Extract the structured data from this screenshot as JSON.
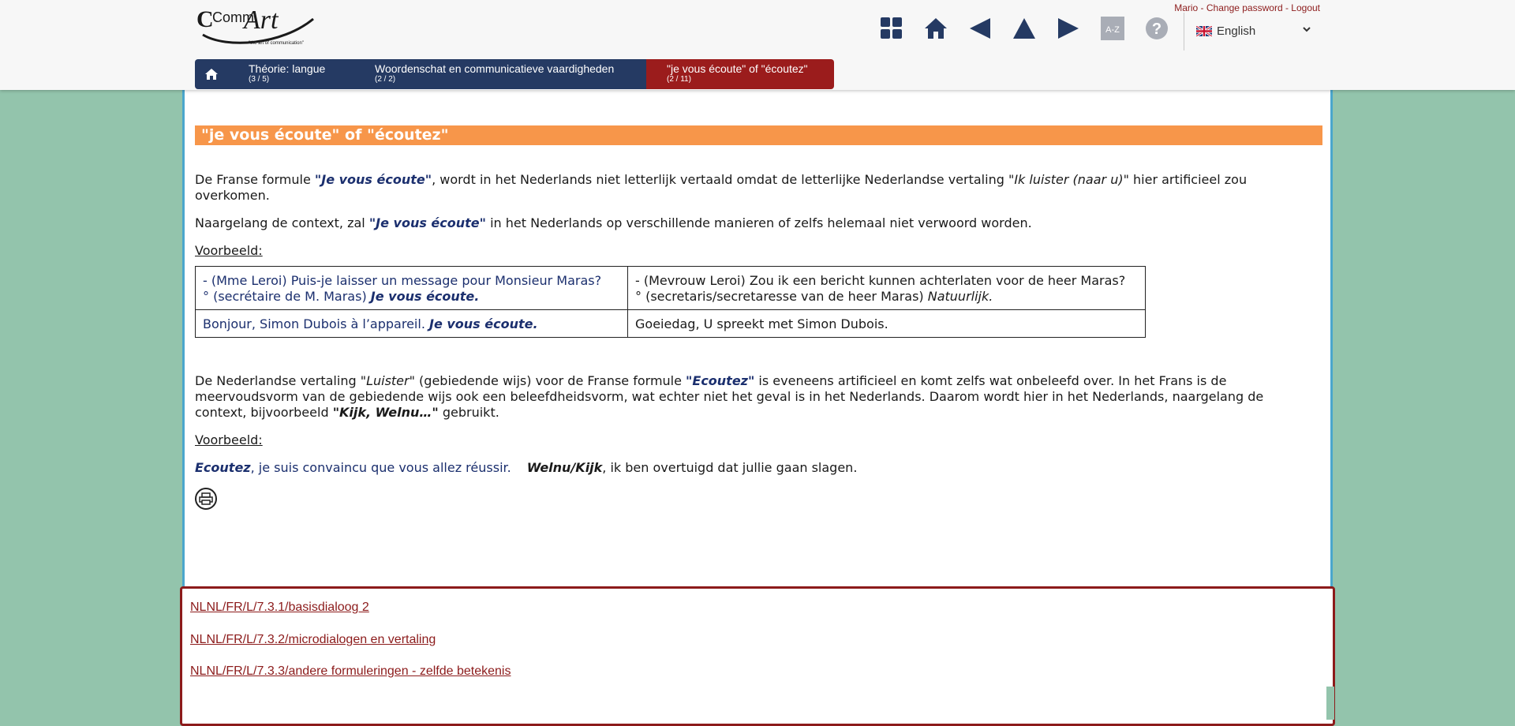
{
  "logo": {
    "name_part1": "Comm",
    "name_part2": "Art",
    "tagline": "\"the art of communication\""
  },
  "user": {
    "name": "Mario",
    "change_password": "Change password",
    "logout": "Logout",
    "sep": " - "
  },
  "toolbar": {
    "az_label": "A-Z",
    "help_label": "?"
  },
  "language": {
    "selected": "English"
  },
  "breadcrumb": [
    {
      "label": "Théorie: langue",
      "count": "(3 / 5)"
    },
    {
      "label": "Woordenschat en communicatieve vaardigheden",
      "count": "(2 / 2)"
    },
    {
      "label": "\"je vous écoute\" of \"écoutez\"",
      "count": "(2 / 11)"
    }
  ],
  "page": {
    "title": "\"je vous écoute\" of  \"écoutez\"",
    "p1": {
      "a": "De Franse formule ",
      "b": "\"Je vous écoute\"",
      "c": ", wordt in het Nederlands niet letterlijk vertaald omdat de letterlijke Nederlandse vertaling \"",
      "d": "Ik luister (naar u)",
      "e": "\" hier artificieel zou overkomen."
    },
    "p2": {
      "a": "Naargelang de context, zal ",
      "b": "\"Je vous écoute\"",
      "c": " in het Nederlands op verschillende manieren of zelfs helemaal niet verwoord worden."
    },
    "example_label_1": "Voorbeeld:",
    "table": {
      "r1_fr_line1": "- (Mme Leroi) Puis-je laisser un message pour Monsieur Maras?",
      "r1_fr_line2a": "° (secrétaire de M. Maras) ",
      "r1_fr_line2b": "Je vous écoute.",
      "r1_nl_line1": "- (Mevrouw Leroi) Zou ik een bericht kunnen achterlaten voor de heer Maras?",
      "r1_nl_line2a": "° (secretaris/secretaresse van de heer Maras) ",
      "r1_nl_line2b": "Natuurlijk.",
      "r2_fr_a": "Bonjour, Simon Dubois à l’appareil. ",
      "r2_fr_b": "Je vous écoute.",
      "r2_nl": "Goeiedag, U spreekt met Simon Dubois."
    },
    "p3": {
      "a": "De Nederlandse vertaling \"",
      "b": "Luister",
      "c": "\" (gebiedende wijs)  voor de Franse formule ",
      "d": "\"Ecoutez\"",
      "e": " is eveneens artificieel en komt zelfs wat onbeleefd over. In het Frans is de meervoudsvorm van de gebiedende wijs ook een beleefdheidsvorm, wat echter niet het geval is in het Nederlands. Daarom wordt hier in het Nederlands, naargelang de context, bijvoorbeeld ",
      "f": "\"Kijk, Welnu…\"",
      "g": " gebruikt."
    },
    "example_label_2": "Voorbeeld:",
    "p4": {
      "a": "Ecoutez",
      "b": ", je suis convaincu que vous allez réussir.",
      "c": "Welnu/Kijk",
      "d": ", ik ben overtuigd dat jullie gaan slagen."
    }
  },
  "related": [
    "NLNL/FR/L/7.3.1/basisdialoog 2",
    "NLNL/FR/L/7.3.2/microdialogen en vertaling",
    "NLNL/FR/L/7.3.3/andere formuleringen - zelfde betekenis"
  ],
  "colors": {
    "background": "#93c4ac",
    "title_bar": "#f7964a",
    "breadcrumb": "#253a63",
    "breadcrumb_active": "#9b1c1c",
    "panel_border": "#4ba6cc",
    "related_border": "#8c1b1b",
    "french_text": "#1b2f6e"
  }
}
